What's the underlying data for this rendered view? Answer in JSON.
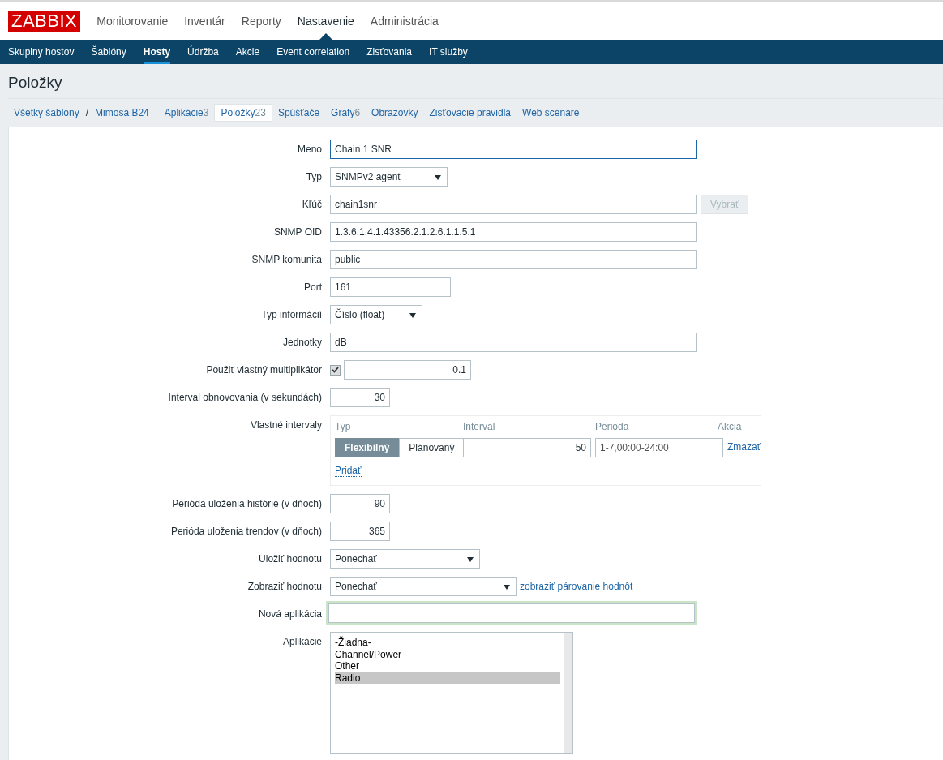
{
  "logo": "ZABBIX",
  "main_menu": [
    {
      "label": "Monitorovanie",
      "selected": false
    },
    {
      "label": "Inventár",
      "selected": false
    },
    {
      "label": "Reporty",
      "selected": false
    },
    {
      "label": "Nastavenie",
      "selected": true
    },
    {
      "label": "Administrácia",
      "selected": false
    }
  ],
  "sub_menu": [
    {
      "label": "Skupiny hostov",
      "selected": false
    },
    {
      "label": "Šablóny",
      "selected": false
    },
    {
      "label": "Hosty",
      "selected": true
    },
    {
      "label": "Údržba",
      "selected": false
    },
    {
      "label": "Akcie",
      "selected": false
    },
    {
      "label": "Event correlation",
      "selected": false
    },
    {
      "label": "Zisťovania",
      "selected": false
    },
    {
      "label": "IT služby",
      "selected": false
    }
  ],
  "page_title": "Položky",
  "breadcrumbs": [
    "Všetky šablóny",
    "Mimosa B24"
  ],
  "breadcrumb_separator": "/",
  "tabs": [
    {
      "label": "Aplikácie",
      "count": "3",
      "selected": false
    },
    {
      "label": "Položky",
      "count": "23",
      "selected": true
    },
    {
      "label": "Spúšťače",
      "selected": false
    },
    {
      "label": "Grafy",
      "count": "6",
      "selected": false
    },
    {
      "label": "Obrazovky",
      "selected": false
    },
    {
      "label": "Zisťovacie pravidlá",
      "selected": false
    },
    {
      "label": "Web scenáre",
      "selected": false
    }
  ],
  "form": {
    "rows": [
      {
        "label": "Meno",
        "kind": "text",
        "value": "Chain 1 SNR",
        "focused": true
      },
      {
        "label": "Typ",
        "kind": "select",
        "value": "SNMPv2 agent"
      },
      {
        "label": "Kľúč",
        "kind": "text-button",
        "value": "chain1snr",
        "button": "Vybrať",
        "disabled": true
      },
      {
        "label": "SNMP OID",
        "kind": "text",
        "value": "1.3.6.1.4.1.43356.2.1.2.6.1.1.5.1",
        "focused": false
      },
      {
        "label": "SNMP komunita",
        "kind": "text",
        "value": "public",
        "focused": false
      },
      {
        "label": "Port",
        "kind": "text",
        "value": "161",
        "focused": false
      },
      {
        "label": "Typ informácií",
        "kind": "select",
        "value": "Číslo (float)"
      },
      {
        "label": "Jednotky",
        "kind": "text",
        "value": "dB",
        "focused": false
      },
      {
        "label": "Použiť vlastný multiplikátor",
        "kind": "checkbox-number",
        "checked": true,
        "value": "0.1"
      },
      {
        "label": "Interval obnovovania (v sekundách)",
        "kind": "number",
        "value": "30"
      },
      {
        "label": "Vlastné intervaly",
        "kind": "intervals",
        "columns": [
          "Typ",
          "Interval",
          "Perióda",
          "Akcia"
        ],
        "rows": [
          {
            "types": [
              {
                "label": "Flexibilný",
                "selected": true
              },
              {
                "label": "Plánovaný",
                "selected": false
              }
            ],
            "interval": "50",
            "period": "1-7,00:00-24:00",
            "action": "Zmazať"
          }
        ],
        "add_link": "Pridať"
      },
      {
        "label": "Perióda uloženia histórie (v dňoch)",
        "kind": "number",
        "value": "90"
      },
      {
        "label": "Perióda uloženia trendov (v dňoch)",
        "kind": "number",
        "value": "365"
      },
      {
        "label": "Uložiť hodnotu",
        "kind": "select",
        "value": "Ponechať"
      },
      {
        "label": "Zobraziť hodnotu",
        "kind": "select-link",
        "value": "Ponechať",
        "link": "zobraziť párovanie hodnôt"
      },
      {
        "label": "Nová aplikácia",
        "kind": "text",
        "value": "",
        "highlighted": true,
        "focused": false
      },
      {
        "label": "Aplikácie",
        "kind": "listbox",
        "items": [
          {
            "label": "-Žiadna-",
            "selected": false
          },
          {
            "label": "Channel/Power",
            "selected": false
          },
          {
            "label": "Other",
            "selected": false
          },
          {
            "label": "Radio",
            "selected": true
          }
        ]
      }
    ]
  }
}
